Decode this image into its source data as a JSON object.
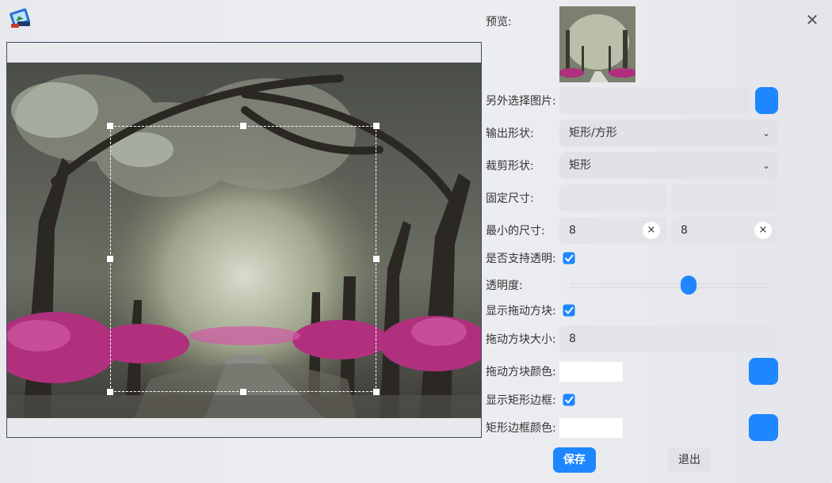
{
  "window": {
    "close_label": "✕"
  },
  "preview": {
    "label": "预览:"
  },
  "choose_image": {
    "label": "另外选择图片:",
    "value": ""
  },
  "output_shape": {
    "label": "输出形状:",
    "value": "矩形/方形"
  },
  "crop_shape": {
    "label": "裁剪形状:",
    "value": "矩形"
  },
  "fixed_size": {
    "label": "固定尺寸:",
    "width": "",
    "height": ""
  },
  "min_size": {
    "label": "最小的尺寸:",
    "width": "8",
    "height": "8",
    "clear_label": "×"
  },
  "support_transparency": {
    "label": "是否支持透明:",
    "checked": true
  },
  "transparency": {
    "label": "透明度:",
    "value": 0.6
  },
  "show_drag_handles": {
    "label": "显示拖动方块:",
    "checked": true
  },
  "drag_handle_size": {
    "label": "拖动方块大小:",
    "value": "8"
  },
  "drag_handle_color": {
    "label": "拖动方块颜色:",
    "color": "#ffffff"
  },
  "show_rect_border": {
    "label": "显示矩形边框:",
    "checked": true
  },
  "rect_border_color": {
    "label": "矩形边框颜色:",
    "color": "#ffffff"
  },
  "actions": {
    "save": "保存",
    "quit": "退出"
  },
  "colors": {
    "accent": "#1e86ff",
    "azalea": "#b0307e"
  }
}
